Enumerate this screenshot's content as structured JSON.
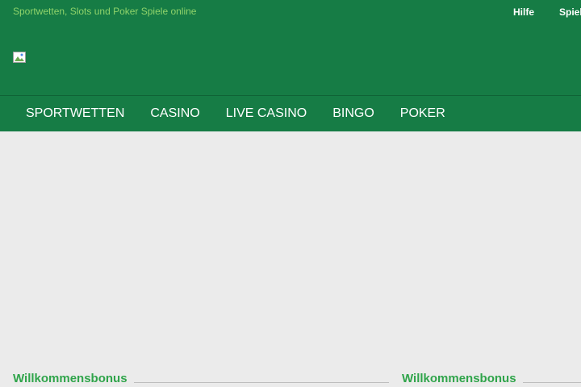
{
  "header": {
    "tagline": "Sportwetten, Slots und Poker Spiele online",
    "links": [
      "Hilfe",
      "Spiel"
    ],
    "logo_icon": "broken-image-icon"
  },
  "nav": {
    "items": [
      "SPORTWETTEN",
      "CASINO",
      "LIVE CASINO",
      "BINGO",
      "POKER"
    ]
  },
  "content": {
    "sections": [
      "Willkommensbonus",
      "Willkommensbonus"
    ]
  },
  "colors": {
    "header_bg": "#167c45",
    "accent_green": "#8fd36a",
    "section_title": "#2fa44a",
    "page_bg": "#ebebeb"
  }
}
